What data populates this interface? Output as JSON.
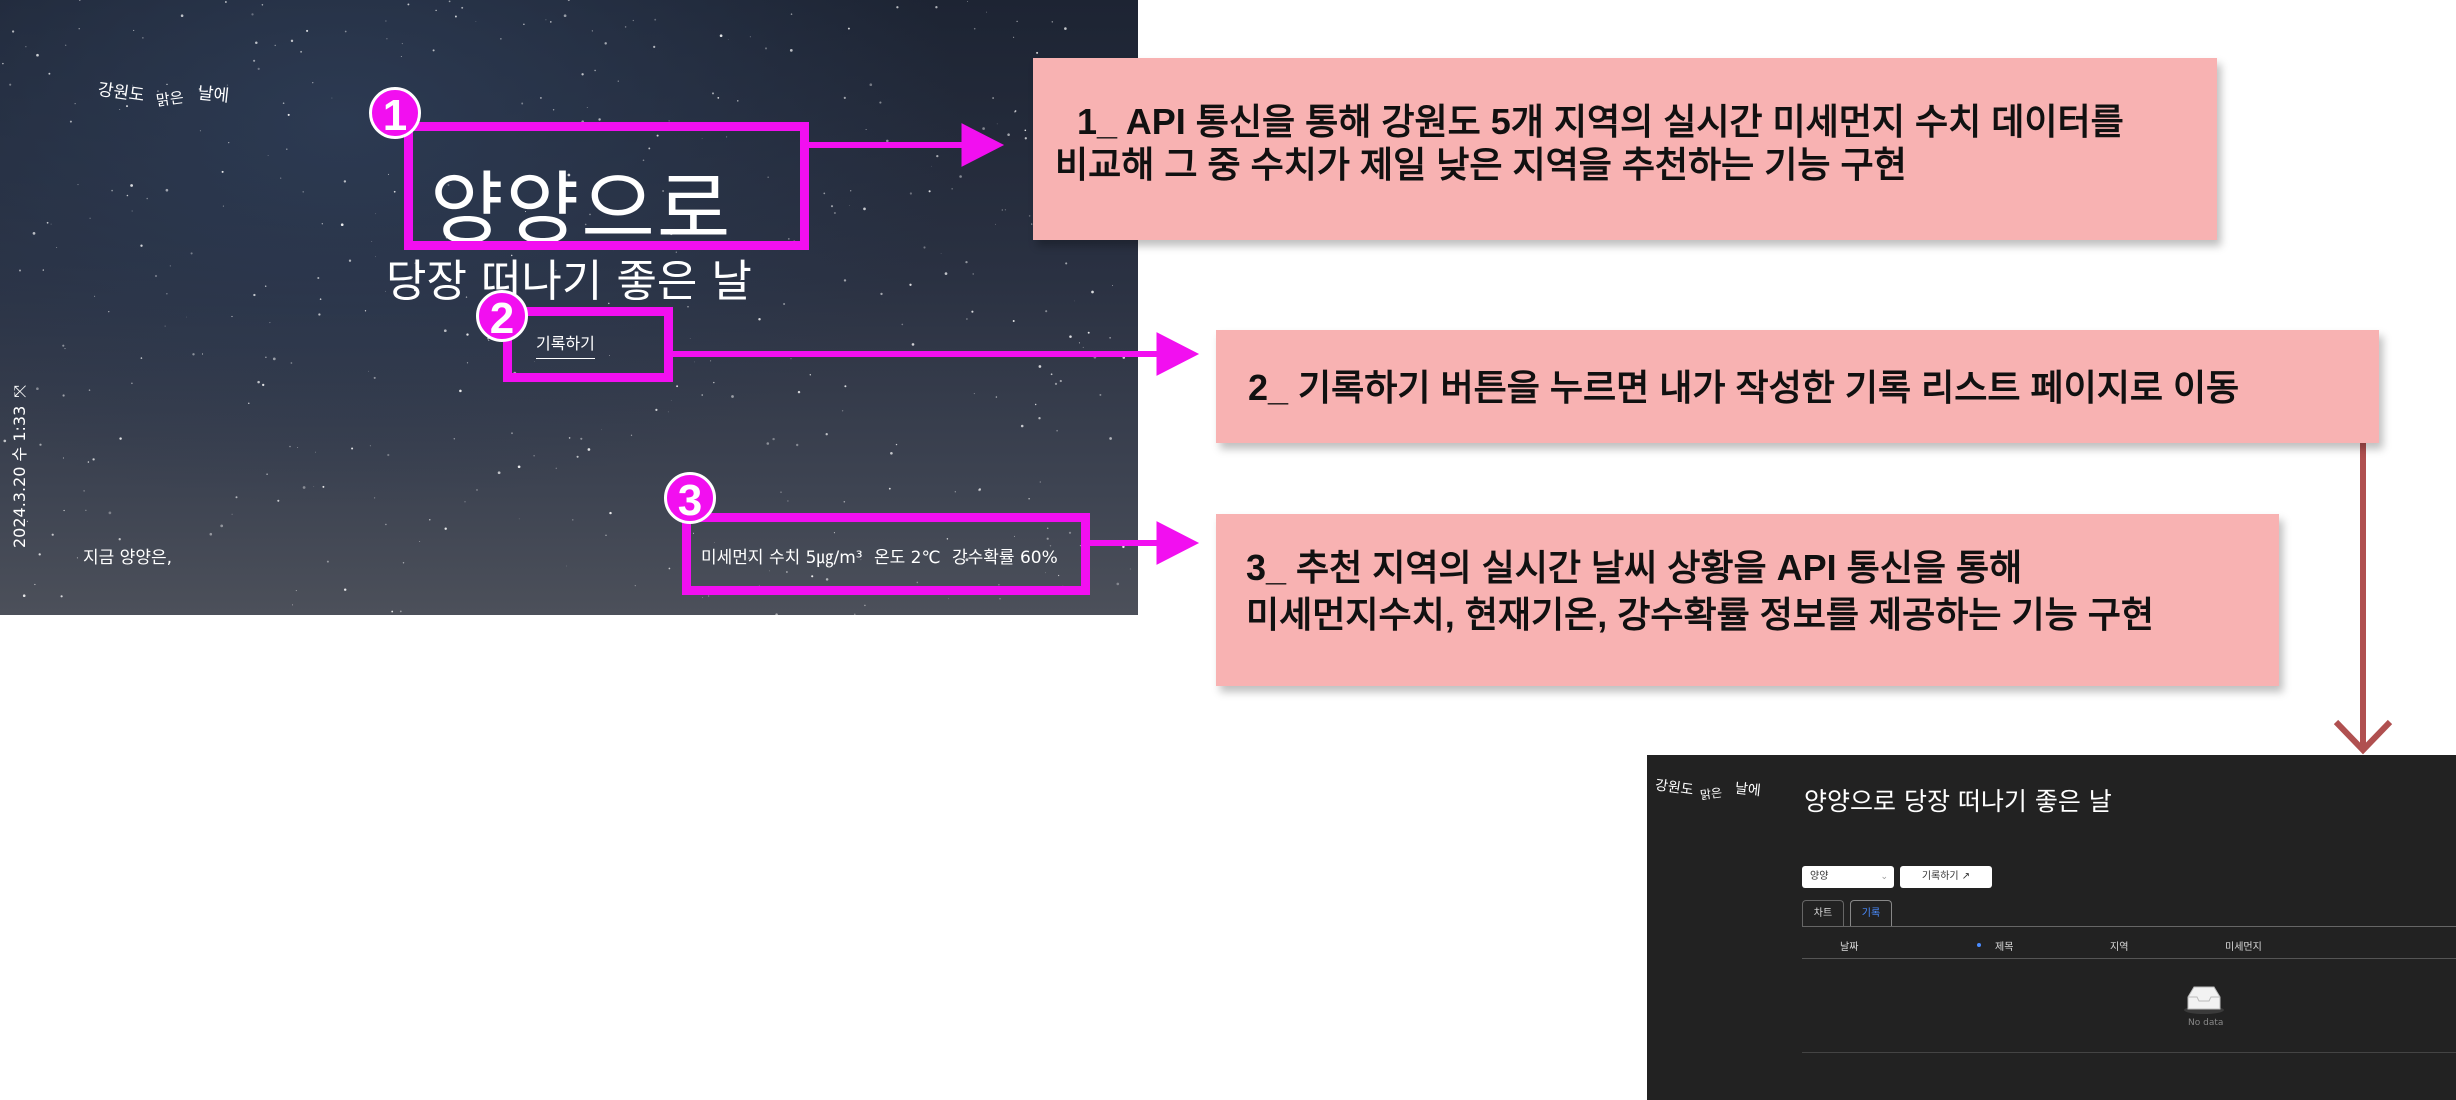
{
  "hero": {
    "logo": {
      "part1": "강원도",
      "part2": "맑은",
      "part3": "날에"
    },
    "title": "양양으로",
    "subtitle": "당장 떠나기 좋은 날",
    "record_link": "기록하기",
    "side_date": "2024.3.20 수 1:33",
    "side_icon": "expand-icon",
    "now_text": "지금 양양은,",
    "weather": {
      "dust": "미세먼지 수치 5㎍/m³",
      "temp": "온도 2℃",
      "rain": "강수확률 60%"
    }
  },
  "annotations": {
    "badges": [
      "1",
      "2",
      "3"
    ],
    "callout1": {
      "line1": "1_ API 통신을 통해 강원도 5개 지역의 실시간 미세먼지 수치 데이터를",
      "line2": "비교해 그 중 수치가 제일 낮은 지역을 추천하는 기능 구현"
    },
    "callout2": {
      "line1": "2_ 기록하기 버튼을 누르면 내가 작성한 기록 리스트 페이지로 이동"
    },
    "callout3": {
      "line1": "3_ 추천 지역의 실시간 날씨 상황을 API 통신을 통해",
      "line2": "미세먼지수치, 현재기온, 강수확률 정보를 제공하는 기능 구현"
    },
    "colors": {
      "magenta": "#f20ff0",
      "callout_bg": "#f8b2b2",
      "link_arrow": "#b05050"
    }
  },
  "list_page": {
    "logo": {
      "part1": "강원도",
      "part2": "맑은",
      "part3": "날에"
    },
    "title": "양양으로 당장 떠나기 좋은 날",
    "region_select": "양양",
    "record_button": "기록하기 ↗",
    "tabs": [
      "차트",
      "기록"
    ],
    "active_tab": "기록",
    "columns": [
      "날짜",
      "제목",
      "지역",
      "미세먼지"
    ],
    "empty_text": "No data",
    "accent": "#4a8cff"
  }
}
